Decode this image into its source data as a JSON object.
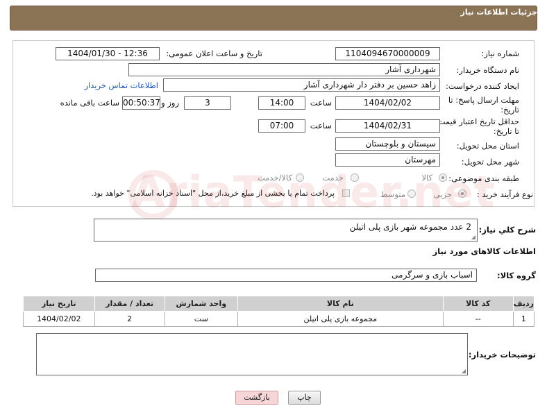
{
  "header": {
    "title": "جزئیات اطلاعات نیاز"
  },
  "form": {
    "need_number_label": "شماره نیاز:",
    "need_number": "1104094670000009",
    "announce_label": "تاریخ و ساعت اعلان عمومی:",
    "announce_value": "1404/01/30 - 12:36",
    "buyer_org_label": "نام دستگاه خریدار:",
    "buyer_org": "شهرداری آشار",
    "creator_label": "ایجاد کننده درخواست:",
    "creator": "زاهد حسین بر دفتر دار شهرداری آشار",
    "contact_link": "اطلاعات تماس خریدار",
    "reply_deadline_label_1": "مهلت ارسال پاسخ: تا",
    "reply_deadline_label_2": "تاریخ:",
    "reply_date": "1404/02/02",
    "time_label": "ساعت",
    "reply_time": "14:00",
    "days_value": "3",
    "days_label": "روز و",
    "remaining_value": "00:50:37",
    "remaining_label": "ساعت باقی مانده",
    "price_validity_label_1": "حداقل تاریخ اعتبار قیمت:",
    "price_validity_label_2": "تا تاریخ:",
    "price_date": "1404/02/31",
    "price_time": "07:00",
    "province_label": "استان محل تحویل:",
    "province": "سیستان و بلوچستان",
    "city_label": "شهر محل تحویل:",
    "city": "مهرستان",
    "category_label": "طبقه بندی موضوعی:",
    "category_options": [
      "کالا",
      "خدمت",
      "کالا/خدمت"
    ],
    "process_label": "نوع فرآیند خرید :",
    "process_options": [
      "جزیی",
      "متوسط"
    ],
    "payment_note": "پرداخت تمام یا بخشی از مبلغ خرید،از محل \"اسناد خزانه اسلامی\" خواهد بود."
  },
  "description": {
    "label": "شرح كلي نياز:",
    "value": "2 عدد مجموعه شهر بازی پلی اتیلن"
  },
  "goods": {
    "section_title": "اطلاعات کالاهای مورد نیاز",
    "group_label": "گروه کالا:",
    "group_value": "اسباب بازی و سرگرمی",
    "columns": [
      "ردیف",
      "کد کالا",
      "نام کالا",
      "واحد شمارش",
      "تعداد / مقدار",
      "تاریخ نیاز"
    ],
    "rows": [
      {
        "index": "1",
        "code": "--",
        "name": "مجموعه بازی پلی اتیلن",
        "unit": "ست",
        "qty": "2",
        "date": "1404/02/02"
      }
    ]
  },
  "buyer_notes": {
    "label": "توضیحات خریدار:",
    "value": ""
  },
  "buttons": {
    "print": "چاپ",
    "back": "بازگشت"
  },
  "watermark": "AriaTender.net"
}
